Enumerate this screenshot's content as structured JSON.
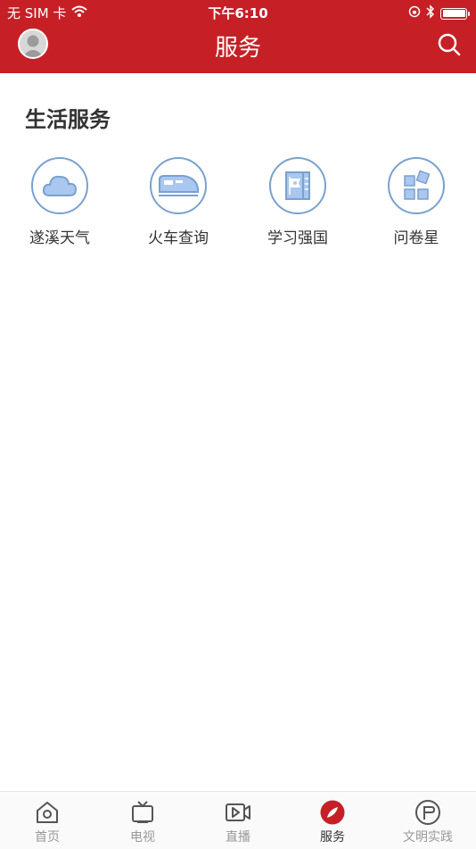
{
  "status": {
    "carrier": "无 SIM 卡",
    "time": "下午6:10"
  },
  "header": {
    "title": "服务"
  },
  "section": {
    "title": "生活服务"
  },
  "services": [
    {
      "label": "遂溪天气",
      "icon": "cloud-icon"
    },
    {
      "label": "火车查询",
      "icon": "train-icon"
    },
    {
      "label": "学习强国",
      "icon": "flag-book-icon"
    },
    {
      "label": "问卷星",
      "icon": "blocks-icon"
    }
  ],
  "tabs": [
    {
      "label": "首页",
      "icon": "home-icon"
    },
    {
      "label": "电视",
      "icon": "tv-icon"
    },
    {
      "label": "直播",
      "icon": "live-video-icon"
    },
    {
      "label": "服务",
      "icon": "compass-icon",
      "active": true
    },
    {
      "label": "文明实践",
      "icon": "practice-icon"
    }
  ],
  "colors": {
    "brand": "#c62026",
    "icon_blue": "#7aa1cf",
    "icon_fill": "#a9c7ef"
  }
}
